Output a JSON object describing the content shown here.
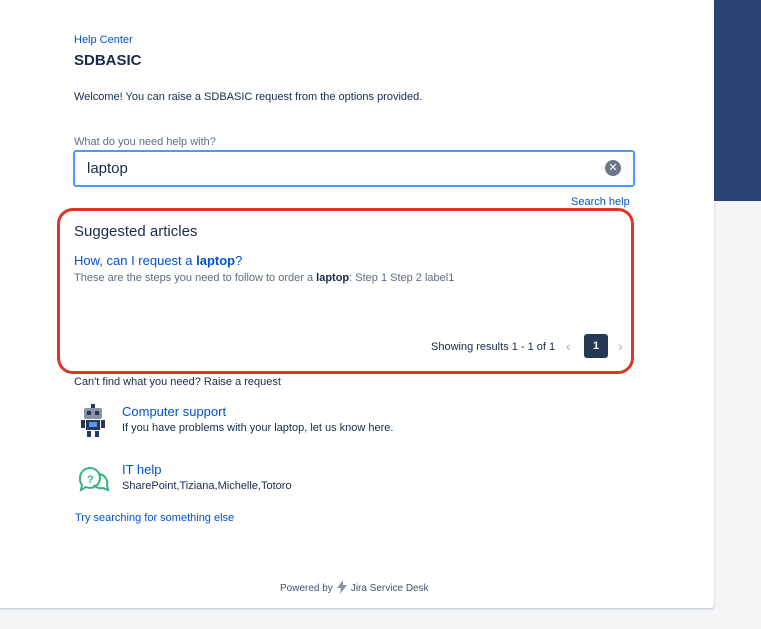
{
  "breadcrumb": "Help Center",
  "title": "SDBASIC",
  "welcome": "Welcome! You can raise a SDBASIC request from the options provided.",
  "search": {
    "label": "What do you need help with?",
    "value": "laptop",
    "clear_icon": "clear-icon",
    "help_link": "Search help"
  },
  "suggested": {
    "heading": "Suggested articles",
    "article": {
      "title_prefix": "How, can I request a ",
      "title_keyword": "laptop",
      "title_suffix": "?",
      "desc_prefix": "These are the steps you need to follow to order a ",
      "desc_keyword": "laptop",
      "desc_suffix": ": Step 1 Step 2 label1"
    },
    "results_text": "Showing results 1 - 1 of 1",
    "page": "1",
    "prev_icon": "chevron-left-icon",
    "next_icon": "chevron-right-icon"
  },
  "raise": {
    "text": "Can't find what you need? Raise a request",
    "types": [
      {
        "title": "Computer support",
        "desc": "If you have problems with your laptop, let us know here.",
        "icon": "robot-icon"
      },
      {
        "title": "IT help",
        "desc": "SharePoint,Tiziana,Michelle,Totoro",
        "icon": "question-chat-icon"
      }
    ]
  },
  "try_search": "Try searching for something else",
  "footer": {
    "powered_by": "Powered by",
    "product": "Jira Service Desk",
    "logo_icon": "jira-bolt-icon"
  },
  "colors": {
    "accent": "#0052cc",
    "highlight_border": "#e53228",
    "side_band": "#2b4475",
    "focus_border": "#4c9aff"
  }
}
